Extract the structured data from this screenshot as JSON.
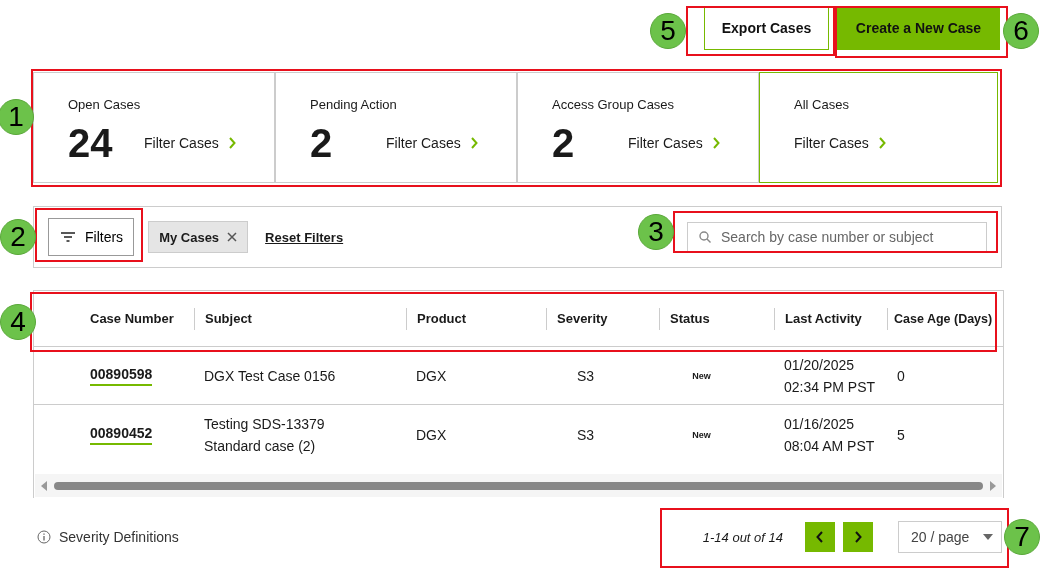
{
  "header_buttons": [
    {
      "label": "Export Cases",
      "kind": "outline"
    },
    {
      "label": "Create a New Case",
      "kind": "primary"
    }
  ],
  "summary_cards": [
    {
      "title": "Open Cases",
      "count": "24",
      "link": "Filter Cases",
      "selected": false
    },
    {
      "title": "Pending Action",
      "count": "2",
      "link": "Filter Cases",
      "selected": false
    },
    {
      "title": "Access Group Cases",
      "count": "2",
      "link": "Filter Cases",
      "selected": false
    },
    {
      "title": "All Cases",
      "link": "Filter Cases",
      "selected": true
    }
  ],
  "filter_bar": {
    "filters_button": "Filters",
    "chips": [
      {
        "label": "My Cases"
      }
    ],
    "reset_link": "Reset Filters",
    "search": {
      "placeholder": "Search by case number or subject"
    }
  },
  "table": {
    "columns": [
      "Case Number",
      "Subject",
      "Product",
      "Severity",
      "Status",
      "Last Activity",
      "Case Age (Days)"
    ],
    "rows": [
      {
        "case_number": "00890598",
        "subject": "DGX Test Case 0156",
        "product": "DGX",
        "severity": "S3",
        "status": "New",
        "date": "01/20/2025",
        "time": "02:34 PM PST",
        "age": "0"
      },
      {
        "case_number": "00890452",
        "subject": "Testing SDS-13379 Standard case (2)",
        "product": "DGX",
        "severity": "S3",
        "status": "New",
        "date": "01/16/2025",
        "time": "08:04 AM PST",
        "age": "5"
      }
    ]
  },
  "footer": {
    "severity_definitions": "Severity Definitions",
    "range": "1-14 out of 14",
    "page_size": "20 / page"
  },
  "annotations": [
    {
      "number": "1"
    },
    {
      "number": "2"
    },
    {
      "number": "3"
    },
    {
      "number": "4"
    },
    {
      "number": "5"
    },
    {
      "number": "6"
    },
    {
      "number": "7"
    }
  ]
}
